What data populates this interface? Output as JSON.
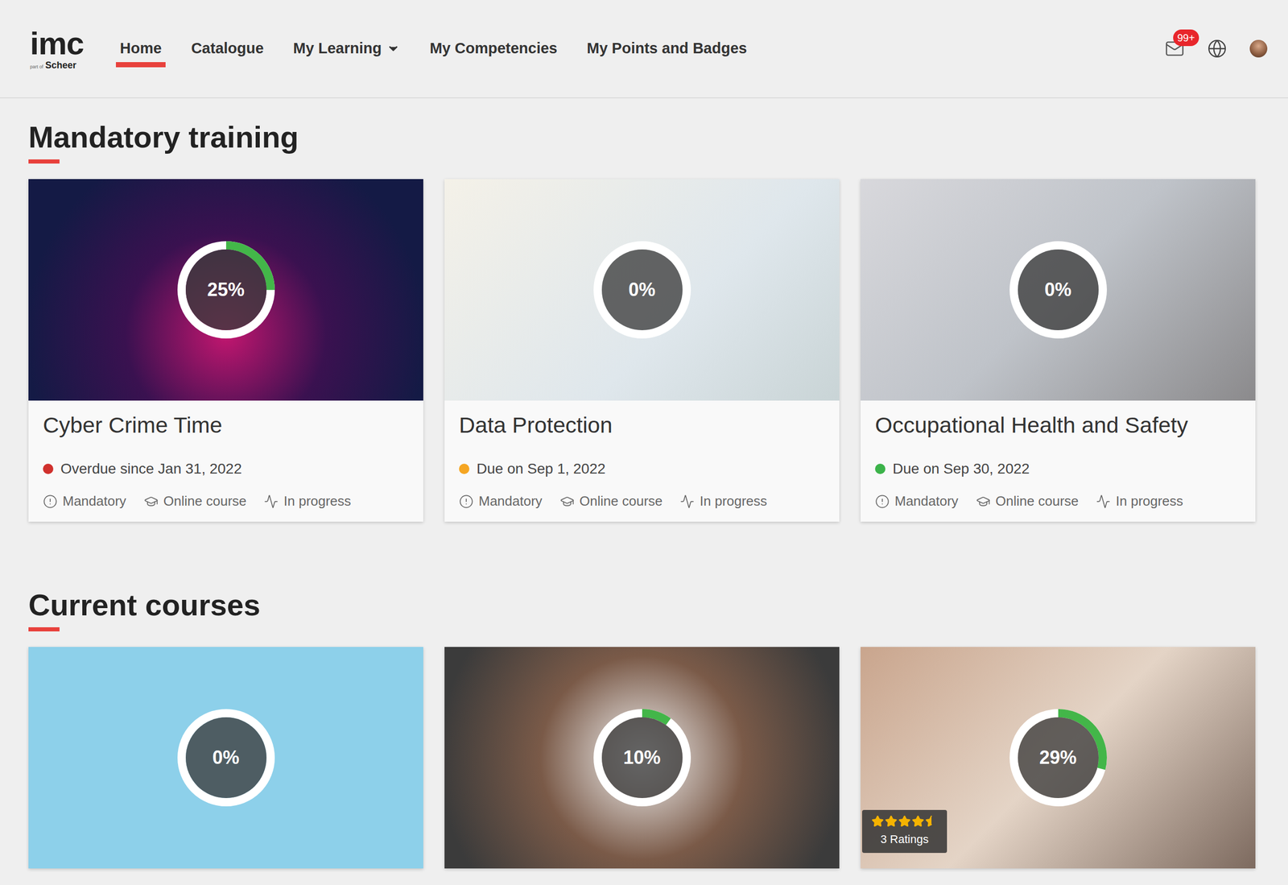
{
  "header": {
    "logo": {
      "text": "imc",
      "sub_prefix": "part of",
      "sub": "Scheer"
    },
    "nav": [
      {
        "label": "Home",
        "selected": true,
        "dropdown": false
      },
      {
        "label": "Catalogue",
        "selected": false,
        "dropdown": false
      },
      {
        "label": "My Learning",
        "selected": false,
        "dropdown": true
      },
      {
        "label": "My Competencies",
        "selected": false,
        "dropdown": false
      },
      {
        "label": "My Points and Badges",
        "selected": false,
        "dropdown": false
      }
    ],
    "mail_badge": "99+"
  },
  "sections": [
    {
      "title": "Mandatory training",
      "cards": [
        {
          "title": "Cyber Crime Time",
          "progress": "25%",
          "level": 0.25,
          "status": "Overdue since Jan 31, 2022",
          "color": "#d0312d",
          "tags": [
            "Mandatory",
            "Online course",
            "In progress"
          ]
        },
        {
          "title": "Data Protection",
          "progress": "0%",
          "level": 0,
          "status": "Due on Sep 1, 2022",
          "color": "#f5a623",
          "tags": [
            "Mandatory",
            "Online course",
            "In progress"
          ]
        },
        {
          "title": "Occupational Health and Safety",
          "progress": "0%",
          "level": 0,
          "status": "Due on Sep 30, 2022",
          "color": "#3cb34a",
          "tags": [
            "Mandatory",
            "Online course",
            "In progress"
          ]
        }
      ]
    },
    {
      "title": "Current courses",
      "cards": [
        {
          "progress": "0%",
          "level": 0
        },
        {
          "progress": "10%",
          "level": 0.1
        },
        {
          "progress": "29%",
          "level": 0.29,
          "rating": {
            "stars": 4.5,
            "label": "3 Ratings"
          }
        }
      ]
    }
  ]
}
